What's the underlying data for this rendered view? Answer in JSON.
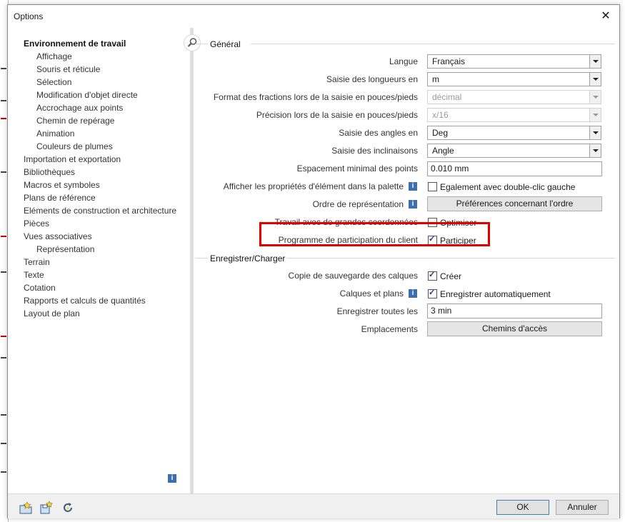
{
  "window": {
    "title": "Options",
    "close_glyph": "✕"
  },
  "nav": {
    "items": [
      {
        "label": "Environnement de travail",
        "level": 0,
        "active": true
      },
      {
        "label": "Affichage",
        "level": 1
      },
      {
        "label": "Souris et réticule",
        "level": 1
      },
      {
        "label": "Sélection",
        "level": 1
      },
      {
        "label": "Modification d'objet directe",
        "level": 1
      },
      {
        "label": "Accrochage aux points",
        "level": 1
      },
      {
        "label": "Chemin de repérage",
        "level": 1
      },
      {
        "label": "Animation",
        "level": 1
      },
      {
        "label": "Couleurs de plumes",
        "level": 1
      },
      {
        "label": "Importation et exportation",
        "level": 0
      },
      {
        "label": "Bibliothèques",
        "level": 0
      },
      {
        "label": "Macros et symboles",
        "level": 0
      },
      {
        "label": "Plans de référence",
        "level": 0
      },
      {
        "label": "Eléments de construction et architecture",
        "level": 0
      },
      {
        "label": "Pièces",
        "level": 0
      },
      {
        "label": "Vues associatives",
        "level": 0
      },
      {
        "label": "Représentation",
        "level": 1
      },
      {
        "label": "Terrain",
        "level": 0
      },
      {
        "label": "Texte",
        "level": 0
      },
      {
        "label": "Cotation",
        "level": 0
      },
      {
        "label": "Rapports et calculs de quantités",
        "level": 0
      },
      {
        "label": "Layout de plan",
        "level": 0
      }
    ],
    "search_icon": "magnifier-icon",
    "info_glyph": "i"
  },
  "general": {
    "title": "Général",
    "langue": {
      "label": "Langue",
      "value": "Français"
    },
    "longueurs": {
      "label": "Saisie des longueurs en",
      "value": "m"
    },
    "fractions": {
      "label": "Format des fractions lors de la saisie en pouces/pieds",
      "value": "décimal"
    },
    "precision": {
      "label": "Précision lors de la saisie en pouces/pieds",
      "value": "x/16"
    },
    "angles": {
      "label": "Saisie des angles en",
      "value": "Deg"
    },
    "inclinaisons": {
      "label": "Saisie des inclinaisons",
      "value": "Angle"
    },
    "espacement": {
      "label": "Espacement minimal des points",
      "value": "0.010 mm"
    },
    "proprietes": {
      "label": "Afficher les propriétés d'élément dans la palette",
      "checkbox": "Egalement avec double-clic gauche",
      "checked": false
    },
    "ordre": {
      "label": "Ordre de représentation",
      "button": "Préférences concernant l'ordre"
    },
    "coordonnees": {
      "label": "Travail avec de grandes coordonnées",
      "checkbox": "Optimiser",
      "checked": false
    },
    "participation": {
      "label": "Programme de participation du client",
      "checkbox": "Participer",
      "checked": true
    }
  },
  "save": {
    "title": "Enregistrer/Charger",
    "copie": {
      "label": "Copie de sauvegarde des calques",
      "checkbox": "Créer",
      "checked": true
    },
    "calques": {
      "label": "Calques et plans",
      "checkbox": "Enregistrer automatiquement",
      "checked": true
    },
    "toutes_les": {
      "label": "Enregistrer toutes les",
      "value": "3 min"
    },
    "emplacements": {
      "label": "Emplacements",
      "button": "Chemins d'accès"
    }
  },
  "footer": {
    "ok": "OK",
    "cancel": "Annuler"
  },
  "colors": {
    "highlight": "#e10000",
    "info": "#3b6fb0"
  }
}
